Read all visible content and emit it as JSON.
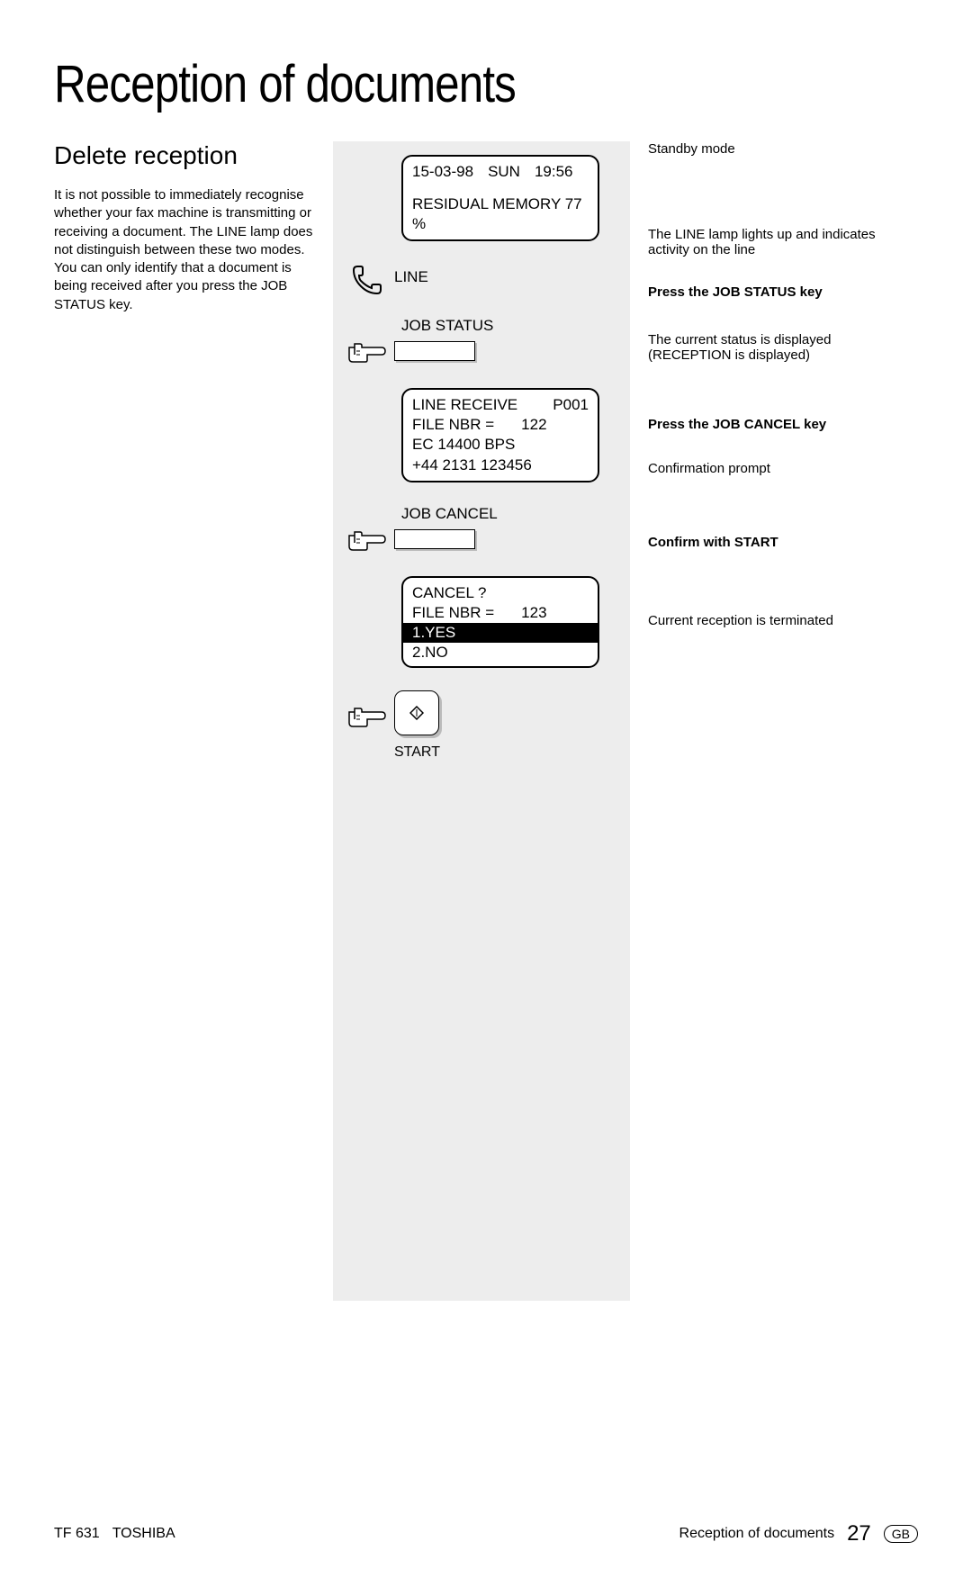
{
  "page_title": "Reception of documents",
  "left": {
    "heading": "Delete reception",
    "body": "It is not possible to immediately recognise whether your fax machine is transmitting or receiving a document. The LINE lamp does not distinguish between these two modes. You can only identify that a document is being received after you press the JOB STATUS key."
  },
  "mid": {
    "standby_lcd": {
      "date": "15-03-98",
      "day": "SUN",
      "time": "19:56",
      "memory": "RESIDUAL MEMORY 77 %"
    },
    "line_label": "LINE",
    "job_status_label": "JOB STATUS",
    "status_lcd": {
      "line1_left": "LINE RECEIVE",
      "line1_right": "P001",
      "line2_left": "FILE NBR =",
      "line2_right": "122",
      "line3": "EC 14400 BPS",
      "line4": "+44 2131 123456"
    },
    "job_cancel_label": "JOB CANCEL",
    "cancel_lcd": {
      "line1": "CANCEL ?",
      "line2_left": "FILE NBR =",
      "line2_right": "123",
      "option_yes": "1.YES",
      "option_no": "2.NO"
    },
    "start_label": "START"
  },
  "right": {
    "standby": "Standby mode",
    "line": "The LINE lamp lights up and indicates activity on the line",
    "job_status": "Press the JOB STATUS key",
    "current_status_1": "The current status is displayed",
    "current_status_2": "(RECEPTION is displayed)",
    "job_cancel": "Press the JOB CANCEL key",
    "confirm_prompt": "Confirmation prompt",
    "confirm_start": "Confirm with START",
    "terminated": "Current reception is terminated"
  },
  "footer": {
    "model": "TF 631",
    "brand": "TOSHIBA",
    "section": "Reception of documents",
    "page": "27",
    "lang": "GB"
  }
}
